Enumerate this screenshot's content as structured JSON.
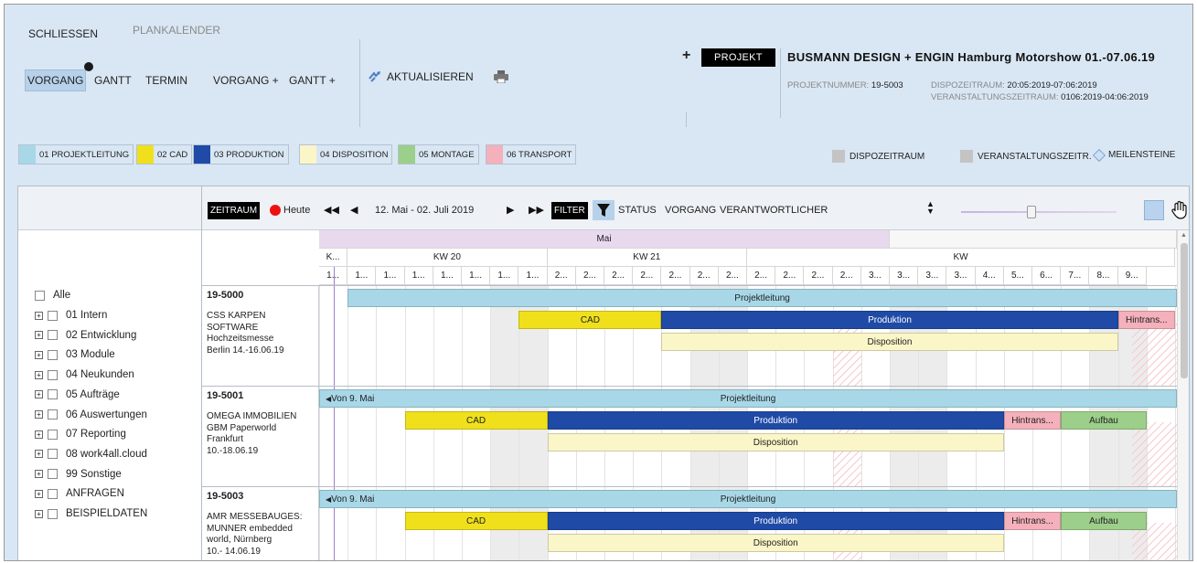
{
  "top_menu": {
    "close": "SCHLIESSEN",
    "plan_calendar": "PLANKALENDER"
  },
  "views": [
    {
      "label": "VORGANG",
      "active": true
    },
    {
      "label": "GANTT"
    },
    {
      "label": "TERMIN"
    },
    {
      "label": "VORGANG +"
    },
    {
      "label": "GANTT +"
    }
  ],
  "actions": {
    "refresh": "AKTUALISIEREN",
    "refresh_icon": "refresh-icon",
    "print_icon": "printer-icon"
  },
  "project": {
    "plus": "+",
    "button": "PROJEKT",
    "title": "BUSMANN DESIGN + ENGIN  Hamburg Motorshow 01.-07.06.19",
    "number_label": "PROJEKTNUMMER:",
    "number": "19-5003",
    "dispo_label": "DISPOZEITRAUM:",
    "dispo": "20:05:2019-07:06:2019",
    "event_label": "VERANSTALTUNGSZEITRAUM:",
    "event": "0106:2019-04:06:2019"
  },
  "legend": [
    {
      "label": "01 PROJEKTLEITUNG",
      "color": "#a8d8e8"
    },
    {
      "label": "02 CAD",
      "color": "#f0e01c"
    },
    {
      "label": "03 PRODUKTION",
      "color": "#1f4aa6"
    },
    {
      "label": "04 DISPOSITION",
      "color": "#fbf6c8"
    },
    {
      "label": "05 MONTAGE",
      "color": "#9ccf8a"
    },
    {
      "label": "06 TRANSPORT",
      "color": "#f4b0bb"
    }
  ],
  "legend_right": {
    "dispo": "DISPOZEITRAUM",
    "event": "VERANSTALTUNGSZEITR.",
    "milestones": "MEILENSTEINE"
  },
  "tree": {
    "all": "Alle",
    "items": [
      "01 Intern",
      "02 Entwicklung",
      "03 Module",
      "04 Neukunden",
      "05 Aufträge",
      "06 Auswertungen",
      "07 Reporting",
      "08 work4all.cloud",
      "99 Sonstige",
      "ANFRAGEN",
      "BEISPIELDATEN"
    ]
  },
  "gantt_toolbar": {
    "zeitraum": "ZEITRAUM",
    "today": "Heute",
    "range": "12. Mai - 02. Juli 2019",
    "filter": "FILTER",
    "status": "STATUS",
    "vorgang": "VORGANG",
    "verantwortlicher": "VERANTWORTLICHER",
    "zoom_level": 0.45
  },
  "timeline": {
    "month": "Mai",
    "weeks": [
      "K...",
      "KW 20",
      "KW 21",
      "KW"
    ],
    "days": [
      "1...",
      "1...",
      "1...",
      "1...",
      "1...",
      "1...",
      "1...",
      "1...",
      "2...",
      "2...",
      "2...",
      "2...",
      "2...",
      "2...",
      "2...",
      "2...",
      "2...",
      "2...",
      "2...",
      "3...",
      "3...",
      "3...",
      "3...",
      "4...",
      "5...",
      "6...",
      "7...",
      "8...",
      "9..."
    ]
  },
  "projects": [
    {
      "id": "19-5000",
      "desc": "CSS KARPEN\nSOFTWARE\nHochzeitsmesse\nBerlin 14.-16.06.19",
      "bars": [
        {
          "label": "Projektleitung",
          "color": "#a8d8e8",
          "start": 1,
          "end": 30.5,
          "row": 0
        },
        {
          "label": "CAD",
          "color": "#f0e01c",
          "start": 7,
          "end": 12,
          "row": 1
        },
        {
          "label": "Produktion",
          "color": "#1f4aa6",
          "text": "#fff",
          "start": 12,
          "end": 28,
          "row": 1
        },
        {
          "label": "Hintrans...",
          "color": "#f4b0bb",
          "start": 28,
          "end": 30,
          "row": 1
        },
        {
          "label": "Disposition",
          "color": "#fbf6c8",
          "start": 12,
          "end": 28,
          "row": 2
        }
      ]
    },
    {
      "id": "19-5001",
      "desc": "OMEGA IMMOBILIEN\nGBM Paperworld\nFrankfurt\n10.-18.06.19",
      "bars": [
        {
          "label": "Projektleitung",
          "prefix": "Von 9. Mai",
          "color": "#a8d8e8",
          "start": 0,
          "end": 30.5,
          "row": 0
        },
        {
          "label": "CAD",
          "color": "#f0e01c",
          "start": 3,
          "end": 8,
          "row": 1
        },
        {
          "label": "Produktion",
          "color": "#1f4aa6",
          "text": "#fff",
          "start": 8,
          "end": 24,
          "row": 1
        },
        {
          "label": "Hintrans...",
          "color": "#f4b0bb",
          "start": 24,
          "end": 26,
          "row": 1
        },
        {
          "label": "Aufbau",
          "color": "#9ccf8a",
          "start": 26,
          "end": 29,
          "row": 1
        },
        {
          "label": "Disposition",
          "color": "#fbf6c8",
          "start": 8,
          "end": 24,
          "row": 2
        }
      ]
    },
    {
      "id": "19-5003",
      "desc": "AMR MESSEBAUGES:\nMUNNER  embedded\nworld, Nürnberg\n10.- 14.06.19",
      "bars": [
        {
          "label": "Projektleitung",
          "prefix": "Von 9. Mai",
          "color": "#a8d8e8",
          "start": 0,
          "end": 30.5,
          "row": 0
        },
        {
          "label": "CAD",
          "color": "#f0e01c",
          "start": 3,
          "end": 8,
          "row": 1
        },
        {
          "label": "Produktion",
          "color": "#1f4aa6",
          "text": "#fff",
          "start": 8,
          "end": 24,
          "row": 1
        },
        {
          "label": "Hintrans...",
          "color": "#f4b0bb",
          "start": 24,
          "end": 26,
          "row": 1
        },
        {
          "label": "Aufbau",
          "color": "#9ccf8a",
          "start": 26,
          "end": 29,
          "row": 1
        },
        {
          "label": "Disposition",
          "color": "#fbf6c8",
          "start": 8,
          "end": 24,
          "row": 2
        }
      ]
    }
  ]
}
